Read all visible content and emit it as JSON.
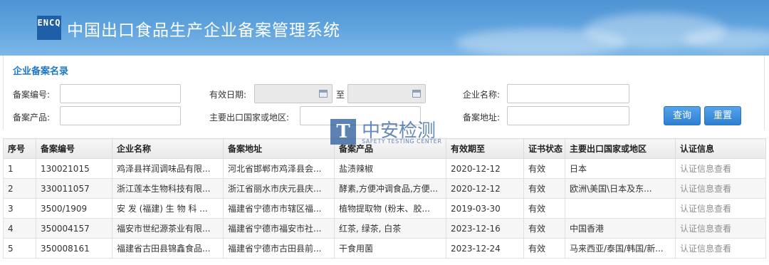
{
  "header": {
    "logo_text": "ENCQ",
    "title": "中国出口食品生产企业备案管理系统"
  },
  "search": {
    "section_title": "企业备案名录",
    "fields": {
      "record_no_label": "备案编号:",
      "record_no_value": "",
      "valid_date_label": "有效日期:",
      "date_from_value": "",
      "date_sep": "至",
      "date_to_value": "",
      "company_label": "企业名称:",
      "company_value": "",
      "product_label": "备案产品:",
      "product_value": "",
      "export_region_label": "主要出口国家或地区:",
      "export_region_value": "",
      "address_label": "备案地址:",
      "address_value": ""
    },
    "query_button": "查询",
    "reset_button": "重置"
  },
  "watermark": {
    "name": "中安检测",
    "subtitle": "SAFETY TESTING CENTER"
  },
  "table": {
    "headers": [
      "序号",
      "备案编号",
      "企业名称",
      "备案地址",
      "备案产品",
      "有效期至",
      "证书状态",
      "主要出口国家或地区",
      "认证信息"
    ],
    "rows": [
      [
        "1",
        "130021015",
        "鸡泽县祥润调味品有限...",
        "河北省邯郸市鸡泽县会...",
        "盐渍辣椒",
        "2020-12-12",
        "有效",
        "日本",
        "认证信息查看"
      ],
      [
        "2",
        "330011057",
        "浙江莲本生物科技有限...",
        "浙江省丽水市庆元县庆...",
        "酵素,方便冲调食品,方便...",
        "2020-12-12",
        "有效",
        "欧洲\\美国\\日本及东...",
        "认证信息查看"
      ],
      [
        "3",
        "3500/1909",
        "安 发 (福建) 生 物 科 ...",
        "福建省宁德市市辖区福...",
        "植物提取物 (粉末、胶...",
        "2019-03-30",
        "有效",
        "",
        "认证信息查看"
      ],
      [
        "4",
        "350004157",
        "福安市世纪源茶业有限...",
        "福建省宁德市福安市社...",
        "红茶, 绿茶, 白茶",
        "2023-12-16",
        "有效",
        "中国香港",
        "认证信息查看"
      ],
      [
        "5",
        "350008161",
        "福建省古田县锦鑫食品...",
        "福建省宁德市古田县前...",
        "干食用菌",
        "2023-12-24",
        "有效",
        "马来西亚/泰国/韩国/新...",
        "认证信息查看"
      ]
    ]
  }
}
